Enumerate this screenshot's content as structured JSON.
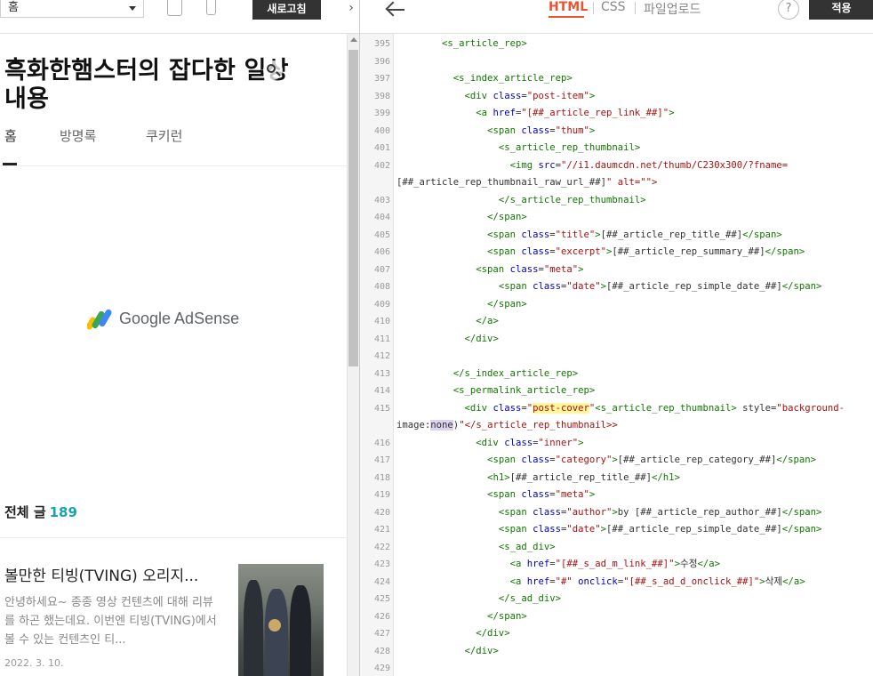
{
  "preview_toolbar": {
    "page_select_value": "홈",
    "refresh_label": "새로고침",
    "collapse_arrow": "›"
  },
  "blog": {
    "title_line1": "흑화한햄스터의 잡다한 일상",
    "title_line2": "내용",
    "nav": [
      "홈",
      "방명록",
      "쿠키런"
    ],
    "adsense_label": "Google AdSense",
    "total_label": "전체 글",
    "total_count": "189",
    "post": {
      "title": "볼만한 티빙(TVING) 오리지...",
      "excerpt": "안녕하세요~ 종종 영상 컨텐츠에 대해 리뷰를 하곤 했는데요. 이번엔 티빙(TVING)에서 볼 수 있는 컨텐츠인 티...",
      "date": "2022. 3. 10."
    }
  },
  "editor": {
    "tabs": [
      "HTML",
      "CSS",
      "파일업로드"
    ],
    "active_tab": "HTML",
    "help_label": "?",
    "apply_label": "적용",
    "accent_color": "#e9542e"
  },
  "code_lines": [
    {
      "n": "395",
      "t": "        <s_article_rep>"
    },
    {
      "n": "396",
      "t": ""
    },
    {
      "n": "397",
      "t": "          <s_index_article_rep>"
    },
    {
      "n": "398",
      "t": "            <div class=\"post-item\">"
    },
    {
      "n": "399",
      "t": "              <a href=\"[##_article_rep_link_##]\">"
    },
    {
      "n": "400",
      "t": "                <span class=\"thum\">"
    },
    {
      "n": "401",
      "t": "                  <s_article_rep_thumbnail>"
    },
    {
      "n": "402",
      "t": "                    <img src=\"//i1.daumcdn.net/thumb/C230x300/?fname="
    },
    {
      "n": "",
      "t": "[##_article_rep_thumbnail_raw_url_##]\" alt=\"\">"
    },
    {
      "n": "403",
      "t": "                  </s_article_rep_thumbnail>"
    },
    {
      "n": "404",
      "t": "                </span>"
    },
    {
      "n": "405",
      "t": "                <span class=\"title\">[##_article_rep_title_##]</span>"
    },
    {
      "n": "406",
      "t": "                <span class=\"excerpt\">[##_article_rep_summary_##]</span>"
    },
    {
      "n": "407",
      "t": "              <span class=\"meta\">"
    },
    {
      "n": "408",
      "t": "                  <span class=\"date\">[##_article_rep_simple_date_##]</span>"
    },
    {
      "n": "409",
      "t": "                </span>"
    },
    {
      "n": "410",
      "t": "              </a>"
    },
    {
      "n": "411",
      "t": "            </div>"
    },
    {
      "n": "412",
      "t": ""
    },
    {
      "n": "413",
      "t": "          </s_index_article_rep>"
    },
    {
      "n": "414",
      "t": "          <s_permalink_article_rep>"
    },
    {
      "n": "415",
      "t": "            <div class=\"post-cover\"<s_article_rep_thumbnail> style=\"background-"
    },
    {
      "n": "",
      "t": "image:none)\"</s_article_rep_thumbnail>>"
    },
    {
      "n": "416",
      "t": "              <div class=\"inner\">"
    },
    {
      "n": "417",
      "t": "                <span class=\"category\">[##_article_rep_category_##]</span>"
    },
    {
      "n": "418",
      "t": "                <h1>[##_article_rep_title_##]</h1>"
    },
    {
      "n": "419",
      "t": "                <span class=\"meta\">"
    },
    {
      "n": "420",
      "t": "                  <span class=\"author\">by [##_article_rep_author_##]</span>"
    },
    {
      "n": "421",
      "t": "                  <span class=\"date\">[##_article_rep_simple_date_##]</span>"
    },
    {
      "n": "422",
      "t": "                  <s_ad_div>"
    },
    {
      "n": "423",
      "t": "                    <a href=\"[##_s_ad_m_link_##]\">수정</a>"
    },
    {
      "n": "424",
      "t": "                    <a href=\"#\" onclick=\"[##_s_ad_d_onclick_##]\">삭제</a>"
    },
    {
      "n": "425",
      "t": "                  </s_ad_div>"
    },
    {
      "n": "426",
      "t": "                </span>"
    },
    {
      "n": "427",
      "t": "              </div>"
    },
    {
      "n": "428",
      "t": "            </div>"
    },
    {
      "n": "429",
      "t": ""
    }
  ]
}
